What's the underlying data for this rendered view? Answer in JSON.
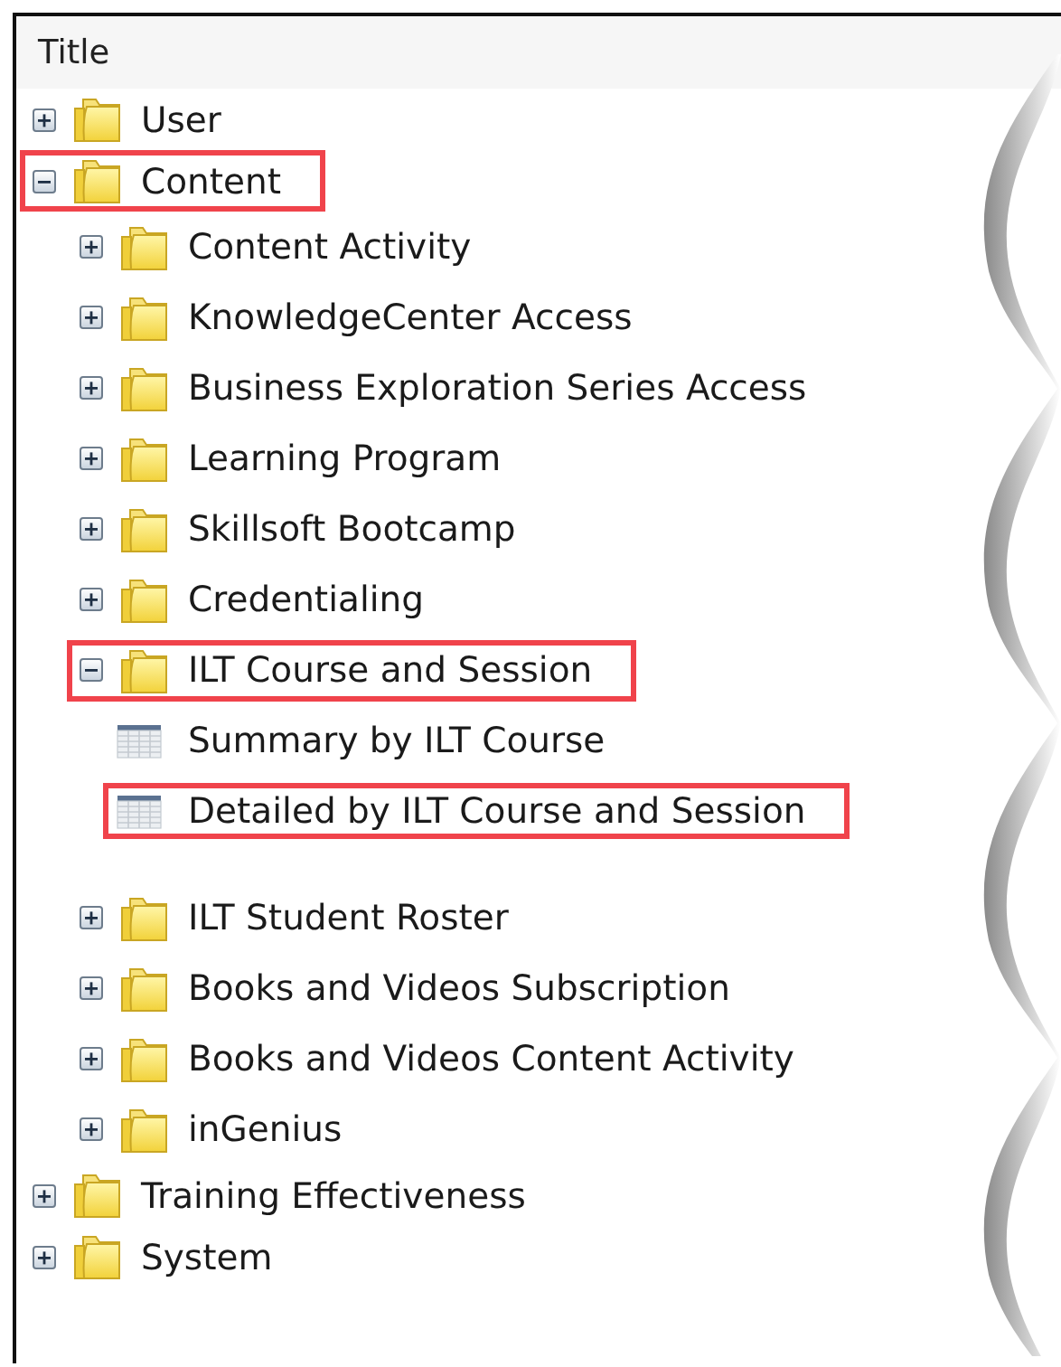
{
  "header": {
    "title": "Title"
  },
  "tree": [
    {
      "kind": "folder",
      "label": "User",
      "expanded": false,
      "highlighted": false
    },
    {
      "kind": "folder",
      "label": "Content",
      "expanded": true,
      "highlighted": true,
      "children": [
        {
          "kind": "folder",
          "label": "Content Activity",
          "expanded": false,
          "highlighted": false
        },
        {
          "kind": "folder",
          "label": "KnowledgeCenter Access",
          "expanded": false,
          "highlighted": false
        },
        {
          "kind": "folder",
          "label": "Business Exploration Series Access",
          "expanded": false,
          "highlighted": false
        },
        {
          "kind": "folder",
          "label": "Learning Program",
          "expanded": false,
          "highlighted": false
        },
        {
          "kind": "folder",
          "label": "Skillsoft Bootcamp",
          "expanded": false,
          "highlighted": false
        },
        {
          "kind": "folder",
          "label": "Credentialing",
          "expanded": false,
          "highlighted": false
        },
        {
          "kind": "folder",
          "label": "ILT Course and Session",
          "expanded": true,
          "highlighted": true,
          "children": [
            {
              "kind": "report",
              "label": "Summary by ILT Course",
              "highlighted": false
            },
            {
              "kind": "report",
              "label": "Detailed by ILT Course and Session",
              "highlighted": true
            }
          ]
        },
        {
          "kind": "folder",
          "label": "ILT Student Roster",
          "expanded": false,
          "highlighted": false
        },
        {
          "kind": "folder",
          "label": "Books and Videos Subscription",
          "expanded": false,
          "highlighted": false
        },
        {
          "kind": "folder",
          "label": "Books and Videos Content Activity",
          "expanded": false,
          "highlighted": false
        },
        {
          "kind": "folder",
          "label": "inGenius",
          "expanded": false,
          "highlighted": false
        }
      ]
    },
    {
      "kind": "folder",
      "label": "Training Effectiveness",
      "expanded": false,
      "highlighted": false
    },
    {
      "kind": "folder",
      "label": "System",
      "expanded": false,
      "highlighted": false
    }
  ]
}
